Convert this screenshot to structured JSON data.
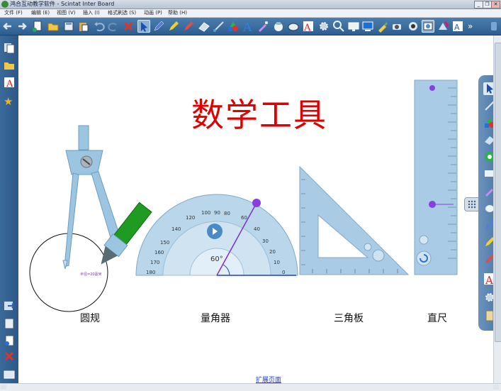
{
  "window": {
    "title": "鸿合互动教学软件 - Scintat Inter Board",
    "buttons": [
      "_",
      "❐",
      "✕"
    ]
  },
  "menubar": {
    "items": [
      "文件 (F)",
      "编辑 (E)",
      "视图 (V)",
      "插入 (I)",
      "格式刷选 (S)",
      "动画 (P)",
      "帮助 (H)"
    ]
  },
  "toolbar": {
    "items": [
      "back-icon",
      "forward-icon",
      "new-page-icon",
      "open-folder-icon",
      "save-icon",
      "paste-icon",
      "undo-icon",
      "redo-icon",
      "delete-icon",
      "select-arrow-icon",
      "pen-icon",
      "highlighter-icon",
      "brush-icon",
      "eraser-icon",
      "line-icon",
      "shape-icon",
      "text-icon",
      "magic-pen-icon",
      "recorder-icon",
      "camera-capture-icon",
      "text-recognition-icon",
      "settings-icon",
      "zoom-icon",
      "screen-icon",
      "monitor-icon",
      "paint-icon",
      "camera-icon",
      "spotlight-icon",
      "screenshot-icon",
      "tools-icon",
      "text-tool-icon"
    ],
    "more_label": "»"
  },
  "canvas": {
    "title": "数学工具",
    "tools": [
      {
        "id": "compass",
        "caption": "圆规"
      },
      {
        "id": "protractor",
        "caption": "量角器"
      },
      {
        "id": "triangle",
        "caption": "三角板"
      },
      {
        "id": "ruler",
        "caption": "直尺"
      }
    ],
    "compass_radius_label": "半径=20毫米",
    "protractor_angle_label": "60°",
    "extend_page_link": "扩展页面"
  },
  "rightpanel": {
    "items": [
      "select-icon",
      "line-draw-icon",
      "shapes-icon",
      "eraser-icon",
      "refresh-icon",
      "screen-display-icon",
      "color-picker-icon",
      "mouse-icon",
      "pen-icon",
      "highlighter-icon",
      "brush-icon",
      "text-icon",
      "settings-icon",
      "ruler-tool-icon"
    ]
  },
  "colors": {
    "title_red": "#e00000",
    "toolbar_blue": "#3a6a9a",
    "instrument_blue": "#9dc4e2",
    "angle_purple": "#7b2fd6",
    "link_blue": "#1f3fd0"
  }
}
